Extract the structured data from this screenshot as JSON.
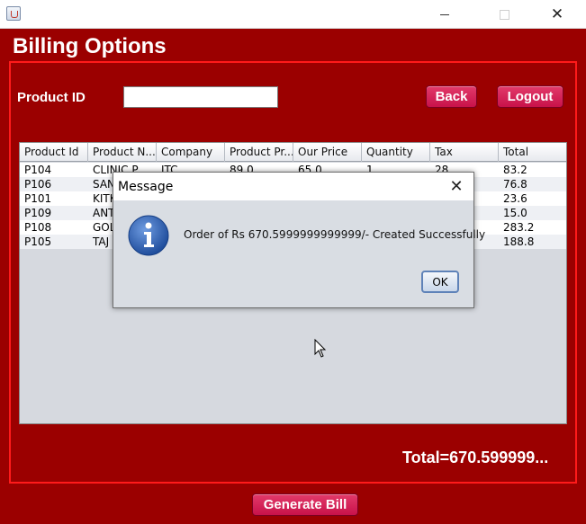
{
  "window": {
    "close_glyph": "✕"
  },
  "header": {
    "title": "Billing Options"
  },
  "form": {
    "product_id_label": "Product ID",
    "product_id_value": "",
    "back_label": "Back",
    "logout_label": "Logout"
  },
  "table": {
    "columns": [
      "Product Id",
      "Product N...",
      "Company",
      "Product Pr...",
      "Our Price",
      "Quantity",
      "Tax",
      "Total"
    ],
    "rows": [
      [
        "P104",
        "CLINIC P...",
        "ITC",
        "89.0",
        "65.0",
        "1",
        "28",
        "83.2"
      ],
      [
        "P106",
        "SAN",
        "",
        "",
        "",
        "",
        "",
        "76.8"
      ],
      [
        "P101",
        "KITK",
        "",
        "",
        "",
        "",
        "",
        "23.6"
      ],
      [
        "P109",
        "ANT",
        "",
        "",
        "",
        "",
        "",
        "15.0"
      ],
      [
        "P108",
        "GOL",
        "",
        "",
        "",
        "",
        "",
        "283.2"
      ],
      [
        "P105",
        "TAJ",
        "",
        "",
        "",
        "",
        "",
        "188.8"
      ]
    ]
  },
  "footer": {
    "total_text": "Total=670.599999...",
    "generate_bill_label": "Generate Bill"
  },
  "dialog": {
    "title": "Message",
    "close_glyph": "✕",
    "message": "Order of Rs 670.5999999999999/- Created Successfully",
    "ok_label": "OK"
  },
  "colors": {
    "background": "#9b0000",
    "panel_border": "#ff1a1a",
    "button": "#d11f55",
    "dialog_bg": "#d9dde3",
    "info_icon": "#2f62b8"
  }
}
